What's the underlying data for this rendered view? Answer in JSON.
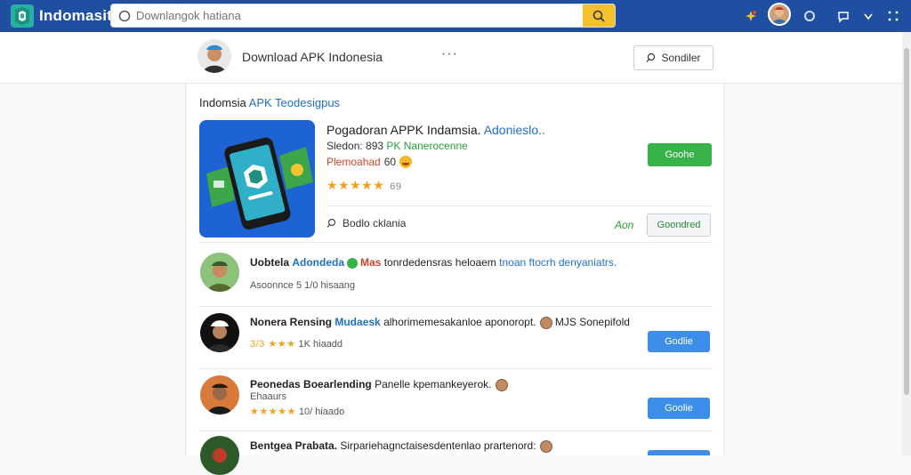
{
  "topbar": {
    "brand": "Indomasit",
    "search_placeholder": "Downlangok hatiana",
    "accent": "#1f4fa0",
    "search_button_color": "#f6c02c"
  },
  "subheader": {
    "title": "Download APK Indonesia",
    "more": "···",
    "button_label": "Sondiler"
  },
  "section": {
    "title_part1": "Indomsia",
    "title_part2": "APK Teodesigpus"
  },
  "featured_app": {
    "title_part1": "Pogadoran APPK Indamsia.",
    "title_part2": "Adonieslo..",
    "meta1_part1": "Sledon:",
    "meta1_part2": "893",
    "meta1_part3": "PK Nanerocenne",
    "meta2": "Plemoahad",
    "meta2_num": "60",
    "rating_stars": "★★★★★",
    "rating_count": "69",
    "primary_button": "Goohe",
    "developer": "Bodlo cklania",
    "label": "Aon",
    "download_button": "Goondred",
    "install_color": "#37b34a"
  },
  "rows": [
    {
      "line1_a": "Uobtela",
      "line1_b": "Adondeda",
      "line1_c": "Mas",
      "line1_d": "tonrdedensras heloaem",
      "line1_e": "tnoan ftocrh denyaniatrs.",
      "line2": "Asoonnce  5  1/0  hisaang"
    },
    {
      "line1_a": "Nonera Rensing",
      "line1_b": "Mudaesk",
      "line1_c": "alhorimemesakanloe aponoropt.",
      "line1_d": "MJS Sonepifold",
      "line2_stars": "3/3 ★★★",
      "line2": "1K  hiaadd",
      "button": "Godlie"
    },
    {
      "line1_a": "Peonedas",
      "line1_b": "Boearlending",
      "line1_c": "Panelle kpemankeyerok.",
      "line2_top": "Ehaaurs",
      "line2_stars": "★★★★★",
      "line2": "10/ hiaado",
      "button": "Goolie"
    },
    {
      "line1_a": "Bentgea Prabata.",
      "line1_b": "Sirpariehagnctaisesdentenlao prartenord:"
    }
  ]
}
